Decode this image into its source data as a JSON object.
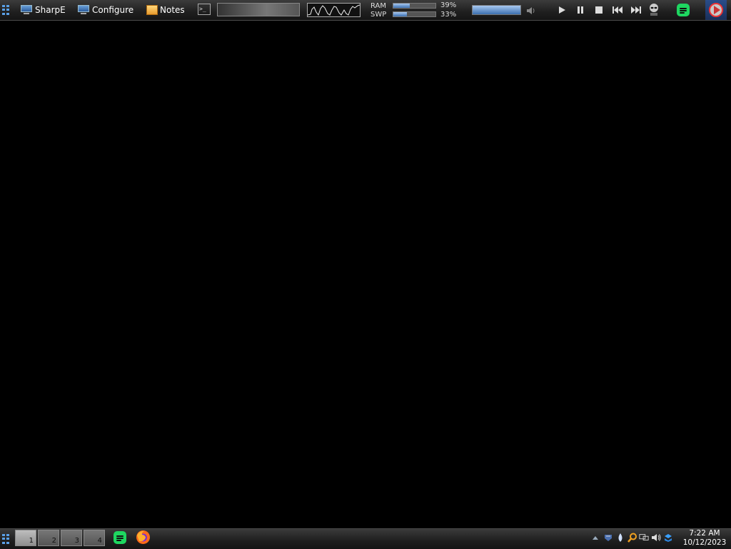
{
  "top_panel": {
    "launchers": [
      {
        "label": "SharpE",
        "icon": "monitor-icon"
      },
      {
        "label": "Configure",
        "icon": "monitor-icon"
      },
      {
        "label": "Notes",
        "icon": "notes-icon"
      }
    ],
    "terminal_icon_text": ">_",
    "memory": {
      "ram_label": "RAM",
      "ram_value": "39%",
      "ram_fraction": 0.39,
      "swap_label": "SWP",
      "swap_value": "33%",
      "swap_fraction": 0.33
    },
    "volume_fraction": 1.0,
    "media_controls": [
      "play-icon",
      "pause-icon",
      "stop-icon",
      "previous-icon",
      "next-icon"
    ]
  },
  "bottom_panel": {
    "desktops": [
      "1",
      "2",
      "3",
      "4"
    ],
    "active_desktop": "1",
    "task_icons": [
      "spotify-icon",
      "firefox-icon"
    ],
    "tray_icons": [
      "tray-expand-icon",
      "shield-icon",
      "droplet-icon",
      "search-icon",
      "network-icon",
      "volume-icon",
      "dropbox-icon"
    ],
    "clock": {
      "time": "7:22 AM",
      "date": "10/12/2023"
    }
  },
  "colors": {
    "panel": "#1f1f1f",
    "desktop_bg": "#000000",
    "accent": "#3b6fb0",
    "spotify": "#1ed760"
  }
}
